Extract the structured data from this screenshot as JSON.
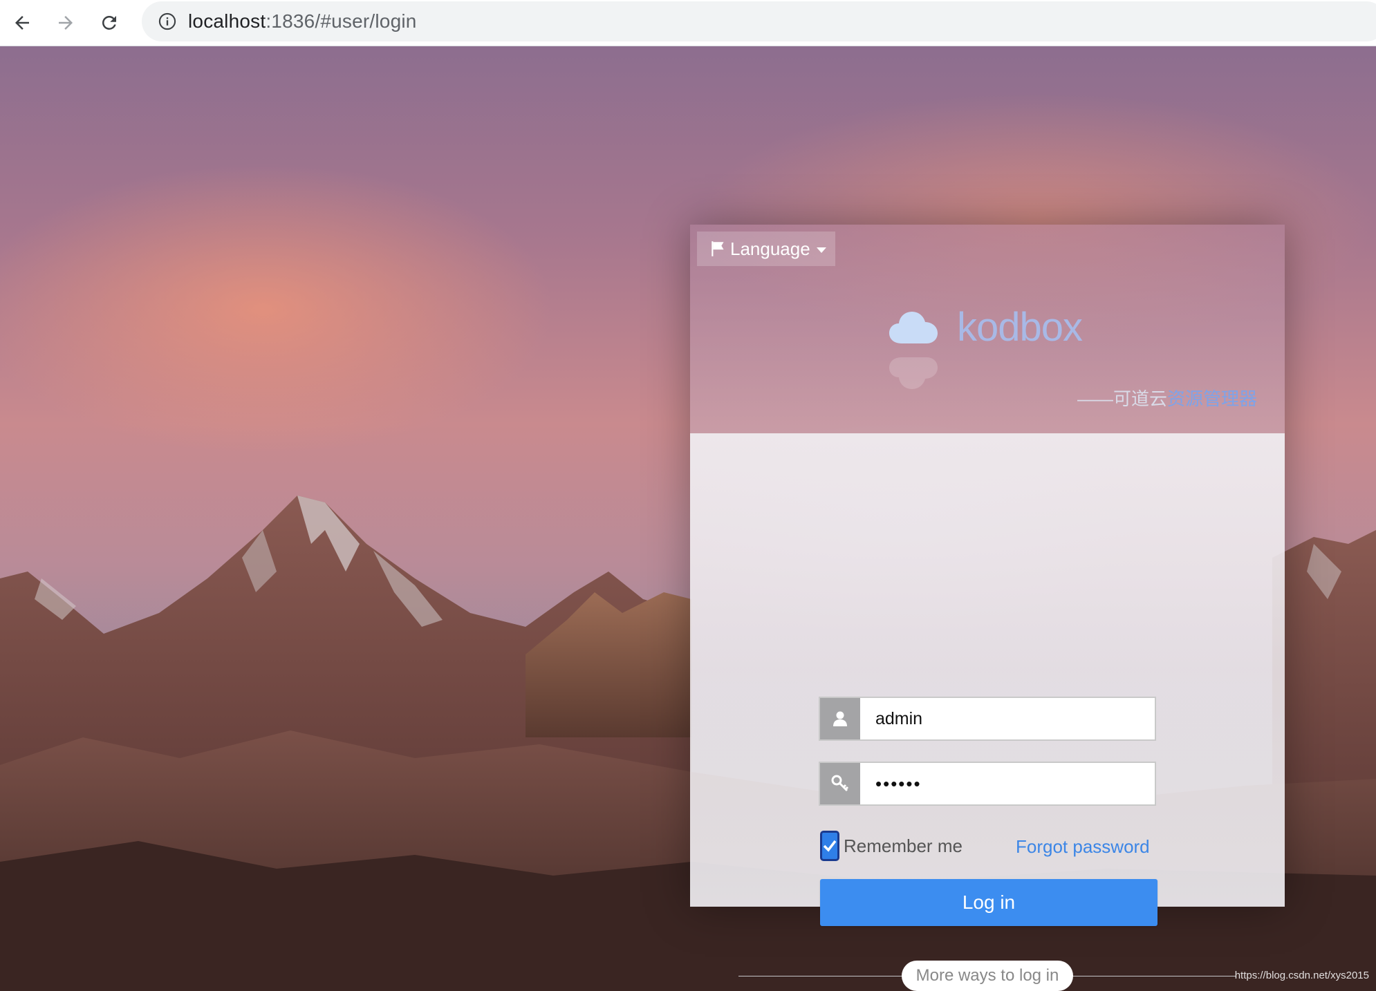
{
  "browser": {
    "url_host": "localhost",
    "url_path": ":1836/#user/login"
  },
  "login": {
    "language_label": "Language",
    "logo_text": "kodbox",
    "slogan_prefix": "——可道云",
    "slogan_accent": "资源管理器",
    "username_value": "admin",
    "password_value": "••••••",
    "remember_label": "Remember me",
    "remember_checked": true,
    "forgot_label": "Forgot password",
    "login_button": "Log in",
    "more_ways_label": "More ways to log in"
  },
  "social": {
    "qq_color": "#2c8ff5",
    "wechat_color": "#3fb838"
  },
  "colors": {
    "primary": "#3c8df0",
    "link": "#3c86e6"
  },
  "watermark": "https://blog.csdn.net/xys2015"
}
